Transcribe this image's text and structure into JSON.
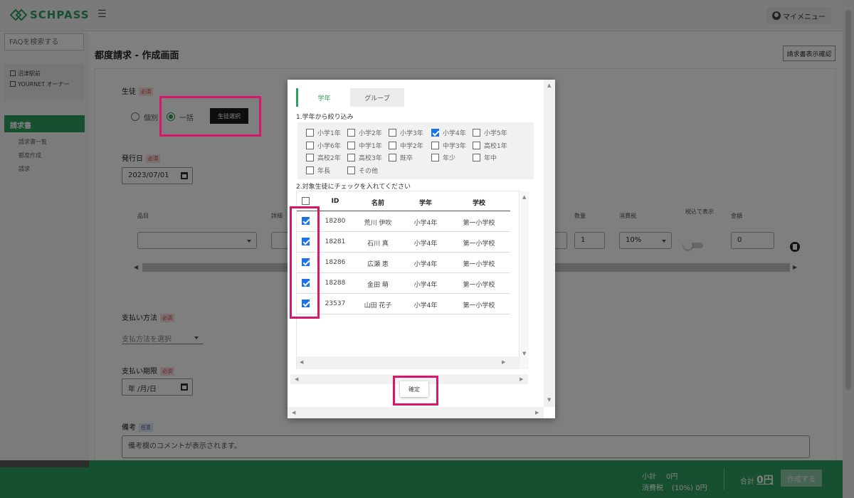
{
  "header": {
    "logo_text": "SCHPASS",
    "hamburger": "☰",
    "my_menu": "マイメニュー"
  },
  "sidebar": {
    "faq_placeholder": "FAQを検索する",
    "station": "沼津駅前",
    "owner": "YOURNET オーナー",
    "active_item": "請求書",
    "sub_items": [
      "請求書一覧",
      "都度作成",
      "請求"
    ]
  },
  "main": {
    "title": "都度請求 - 作成画面",
    "invoice_confirm_button": "請求書表示確認",
    "required_badge": "必須",
    "optional_badge": "任意",
    "student_label": "生徒",
    "radio_individual": "個別",
    "radio_bulk": "一括",
    "select_student_button": "生徒選択",
    "issue_date_label": "発行日",
    "issue_date_value": "2023/07/01",
    "item_headers": [
      "品目",
      "詳細",
      "数量",
      "消費税",
      "税込で表示",
      "金額"
    ],
    "quantity_value": "1",
    "tax_value": "10%",
    "amount_value": "0",
    "payment_method_label": "支払い方法",
    "payment_method_placeholder": "支払方法を選択",
    "payment_due_label": "支払い期限",
    "payment_due_placeholder": "年 /月/日",
    "memo_label": "備考",
    "memo_text": "備考欄のコメントが表示されます。"
  },
  "footer": {
    "subtotal_label": "小計",
    "subtotal_value": "0円",
    "tax_label": "消費税",
    "tax_rate": "(10%) 0円",
    "total_label": "合計",
    "total_value": "0円",
    "create_button": "作成する"
  },
  "modal": {
    "tabs": [
      "学年",
      "グループ"
    ],
    "step1_label": "1.学年から絞り込み",
    "grades": [
      {
        "label": "小学1年",
        "checked": false
      },
      {
        "label": "小学2年",
        "checked": false
      },
      {
        "label": "小学3年",
        "checked": false
      },
      {
        "label": "小学4年",
        "checked": true
      },
      {
        "label": "小学5年",
        "checked": false
      },
      {
        "label": "小学6年",
        "checked": false
      },
      {
        "label": "中学1年",
        "checked": false
      },
      {
        "label": "中学2年",
        "checked": false
      },
      {
        "label": "中学3年",
        "checked": false
      },
      {
        "label": "高校1年",
        "checked": false
      },
      {
        "label": "高校2年",
        "checked": false
      },
      {
        "label": "高校3年",
        "checked": false
      },
      {
        "label": "既卒",
        "checked": false
      },
      {
        "label": "年少",
        "checked": false
      },
      {
        "label": "年中",
        "checked": false
      },
      {
        "label": "年長",
        "checked": false
      },
      {
        "label": "その他",
        "checked": false
      }
    ],
    "step2_label": "2.対象生徒にチェックを入れてください",
    "columns": [
      "ID",
      "名前",
      "学年",
      "学校"
    ],
    "students": [
      {
        "id": "18280",
        "name": "荒川 伊吹",
        "grade": "小学4年",
        "school": "第一小学校",
        "checked": true
      },
      {
        "id": "18281",
        "name": "石川 真",
        "grade": "小学4年",
        "school": "第一小学校",
        "checked": true
      },
      {
        "id": "18286",
        "name": "広瀬 恵",
        "grade": "小学4年",
        "school": "第一小学校",
        "checked": true
      },
      {
        "id": "18288",
        "name": "金田 萌",
        "grade": "小学4年",
        "school": "第一小学校",
        "checked": true
      },
      {
        "id": "23537",
        "name": "山田 花子",
        "grade": "小学4年",
        "school": "第一小学校",
        "checked": true
      }
    ],
    "confirm_button": "確定"
  },
  "colors": {
    "brand": "#2f9e62",
    "highlight": "#d6176a",
    "checkbox": "#1a73e8"
  }
}
